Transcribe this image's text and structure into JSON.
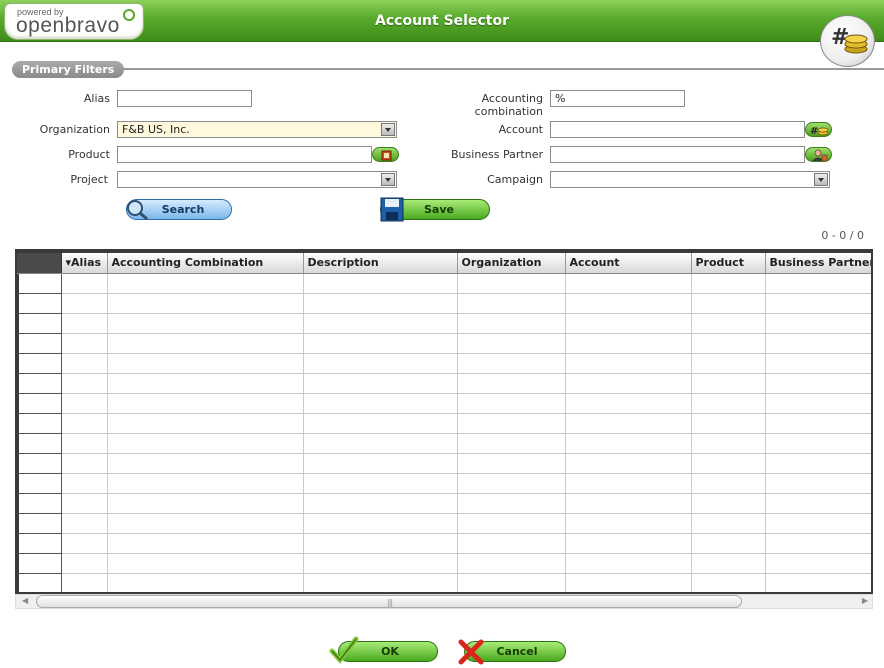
{
  "header": {
    "powered_by": "powered by",
    "brand": "openbravo",
    "title": "Account Selector",
    "badge_symbol": "#"
  },
  "filters": {
    "section_label": "Primary Filters",
    "alias": {
      "label": "Alias",
      "value": ""
    },
    "organization": {
      "label": "Organization",
      "value": "F&B US, Inc."
    },
    "product": {
      "label": "Product",
      "value": ""
    },
    "project": {
      "label": "Project",
      "value": ""
    },
    "accounting_combination": {
      "label_line1": "Accounting",
      "label_line2": "combination",
      "value": "%"
    },
    "account": {
      "label": "Account",
      "value": ""
    },
    "business_partner": {
      "label": "Business Partner",
      "value": ""
    },
    "campaign": {
      "label": "Campaign",
      "value": ""
    }
  },
  "buttons": {
    "search": "Search",
    "save": "Save",
    "ok": "OK",
    "cancel": "Cancel"
  },
  "grid": {
    "count": "0 - 0 / 0",
    "sort_indicator": "▾",
    "columns": [
      "Alias",
      "Accounting Combination",
      "Description",
      "Organization",
      "Account",
      "Product",
      "Business Partner"
    ]
  },
  "colors": {
    "header_green": "#58aa2c",
    "accent_blue": "#2f6fae",
    "org_field_bg": "#fff8dc"
  },
  "icons": [
    "search-icon",
    "save-disk-icon",
    "ok-check-icon",
    "cancel-x-icon",
    "account-selector-icon",
    "product-selector-icon",
    "business-partner-icon"
  ]
}
